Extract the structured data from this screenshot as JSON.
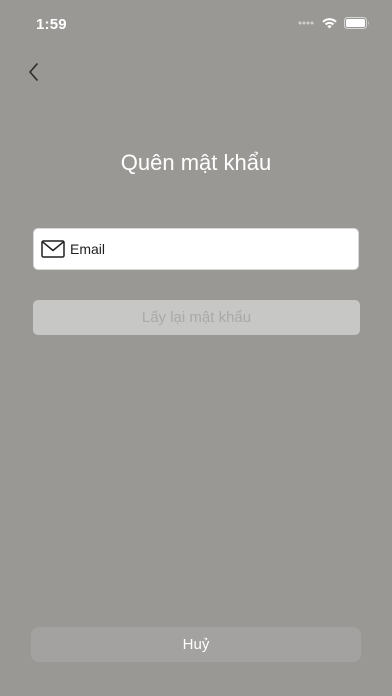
{
  "status_bar": {
    "time": "1:59",
    "icons": [
      "signal-icon",
      "wifi-icon",
      "battery-icon"
    ]
  },
  "header": {
    "back_icon": "chevron-left-icon",
    "title": "Quên mật khẩu"
  },
  "form": {
    "email": {
      "icon": "mail-icon",
      "value": "",
      "placeholder": "Email"
    },
    "submit_label": "Lấy lại mật khẩu"
  },
  "footer": {
    "cancel_label": "Huỷ"
  },
  "colors": {
    "background": "#9a9894",
    "input_background": "#ffffff",
    "disabled_button": "#c7c7c6",
    "disabled_text": "#a9a9a9",
    "cancel_button": "#a4a2a0",
    "text_light": "#ffffff"
  }
}
